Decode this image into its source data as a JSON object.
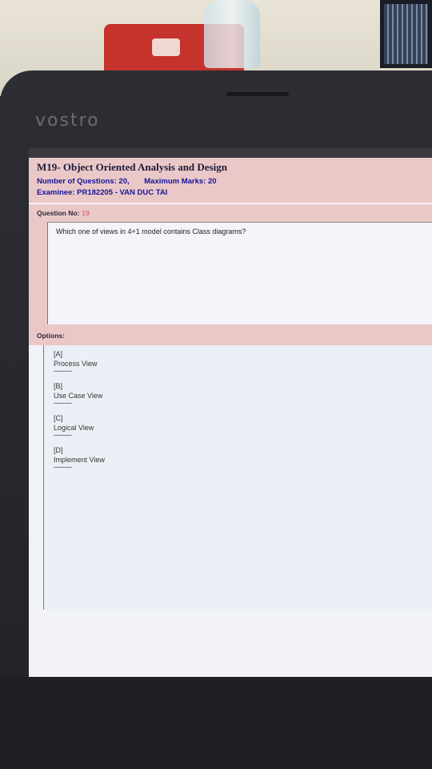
{
  "laptop": {
    "brand": "vostro"
  },
  "exam": {
    "title": "M19- Object Oriented Analysis and Design",
    "questions_label": "Number of Questions:",
    "questions_value": "20,",
    "marks_label": "Maximum Marks:",
    "marks_value": "20",
    "examinee_label": "Examinee:",
    "examinee_value": "PR182205 - VAN DUC TAI"
  },
  "question": {
    "label": "Question No:",
    "number": "19",
    "text": "Which one of views in 4+1 model contains Class diagrams?"
  },
  "options": {
    "label": "Options:",
    "separator": "-----------",
    "items": [
      {
        "key": "[A]",
        "text": "Process View"
      },
      {
        "key": "[B]",
        "text": "Use Case View"
      },
      {
        "key": "[C]",
        "text": "Logical View"
      },
      {
        "key": "[D]",
        "text": "Implement View"
      }
    ]
  }
}
